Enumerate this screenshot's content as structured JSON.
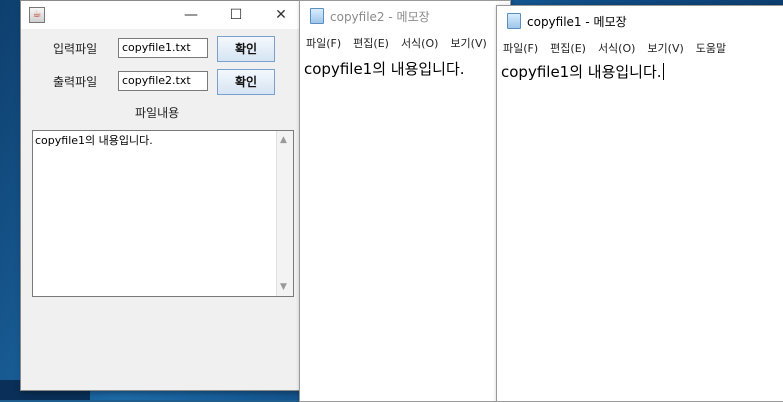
{
  "swing_window": {
    "title": "",
    "app_icon": "java-icon",
    "input_label": "입력파일",
    "input_value": "copyfile1.txt",
    "input_button": "확인",
    "output_label": "출력파일",
    "output_value": "copyfile2.txt",
    "output_button": "확인",
    "content_label": "파일내용",
    "content_text": "copyfile1의 내용입니다.",
    "min_glyph": "—",
    "max_glyph": "☐",
    "close_glyph": "✕"
  },
  "notepad_back": {
    "title": "copyfile2 - 메모장",
    "menu": [
      "파일(F)",
      "편집(E)",
      "서식(O)",
      "보기(V)"
    ],
    "text": "copyfile1의 내용입니다."
  },
  "notepad_front": {
    "title": "copyfile1 - 메모장",
    "menu": [
      "파일(F)",
      "편집(E)",
      "서식(O)",
      "보기(V)",
      "도움말"
    ],
    "text": "copyfile1의 내용입니다."
  }
}
